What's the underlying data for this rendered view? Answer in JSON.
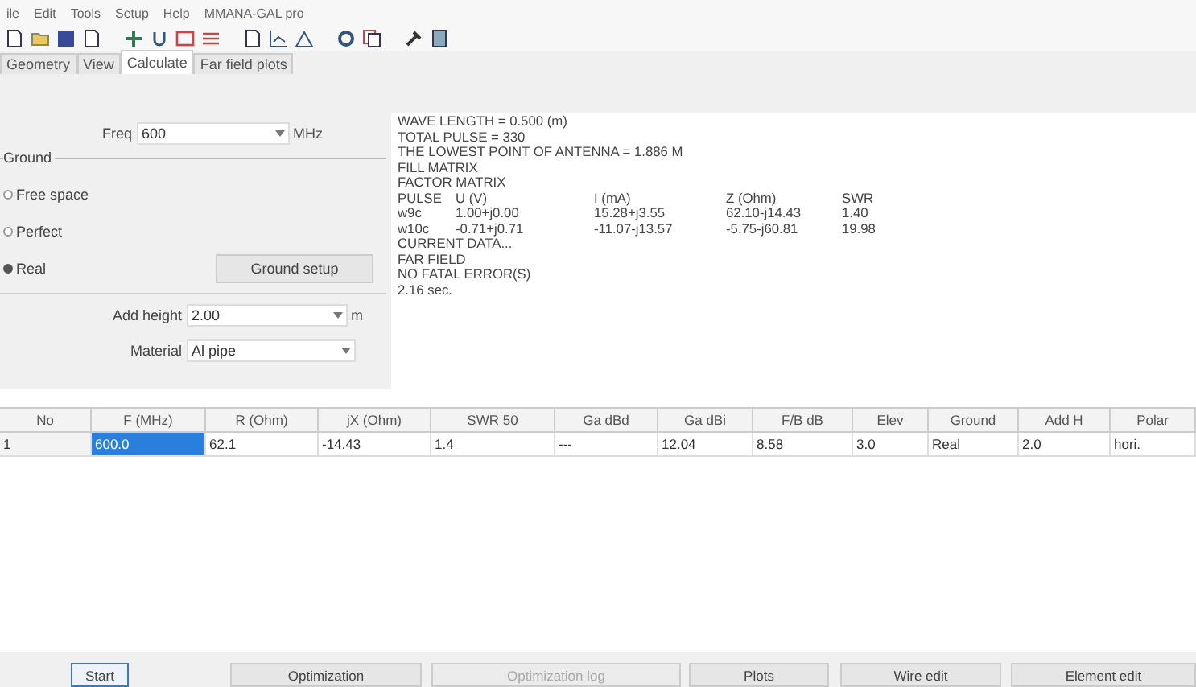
{
  "menu": [
    "ile",
    "Edit",
    "Tools",
    "Setup",
    "Help",
    "MMANA-GAL pro"
  ],
  "tabs": [
    {
      "label": "Geometry",
      "selected": false
    },
    {
      "label": "View",
      "selected": false
    },
    {
      "label": "Calculate",
      "selected": true
    },
    {
      "label": "Far field plots",
      "selected": false
    }
  ],
  "freq": {
    "label": "Freq",
    "value": "600",
    "unit": "MHz"
  },
  "ground": {
    "title": "Ground",
    "options": [
      {
        "label": "Free space",
        "selected": false
      },
      {
        "label": "Perfect",
        "selected": false
      },
      {
        "label": "Real",
        "selected": true
      }
    ],
    "setup_button": "Ground setup"
  },
  "add_height": {
    "label": "Add height",
    "value": "2.00",
    "unit": "m"
  },
  "material": {
    "label": "Material",
    "value": "Al pipe"
  },
  "results": {
    "lines_before": [
      "WAVE LENGTH = 0.500 (m)",
      "TOTAL PULSE = 330",
      "THE LOWEST POINT OF ANTENNA = 1.886 M",
      "FILL MATRIX",
      "FACTOR MATRIX"
    ],
    "pulse_columns": [
      "PULSE",
      "U (V)",
      "I (mA)",
      "Z (Ohm)",
      "SWR"
    ],
    "pulse_rows": [
      [
        "w9c",
        "1.00+j0.00",
        "15.28+j3.55",
        "62.10-j14.43",
        "1.40"
      ],
      [
        "w10c",
        "-0.71+j0.71",
        "-11.07-j13.57",
        "-5.75-j60.81",
        "19.98"
      ]
    ],
    "lines_after": [
      "CURRENT DATA...",
      "FAR FIELD",
      "NO FATAL ERROR(S)",
      "2.16 sec."
    ]
  },
  "table": {
    "columns": [
      "No",
      "F (MHz)",
      "R (Ohm)",
      "jX (Ohm)",
      "SWR 50",
      "Ga dBd",
      "Ga dBi",
      "F/B dB",
      "Elev",
      "Ground",
      "Add H",
      "Polar"
    ],
    "rows": [
      {
        "selected": true,
        "cells": [
          "1",
          "600.0",
          "62.1",
          "-14.43",
          "1.4",
          "---",
          "12.04",
          "8.58",
          "3.0",
          "Real",
          "2.0",
          "hori."
        ]
      }
    ]
  },
  "buttons": [
    {
      "label": "Start",
      "disabled": false,
      "focused": true
    },
    {
      "label": "Optimization",
      "disabled": false,
      "focused": false
    },
    {
      "label": "Optimization log",
      "disabled": true,
      "focused": false
    },
    {
      "label": "Plots",
      "disabled": false,
      "focused": false
    },
    {
      "label": "Wire edit",
      "disabled": false,
      "focused": false
    },
    {
      "label": "Element edit",
      "disabled": false,
      "focused": false
    }
  ]
}
